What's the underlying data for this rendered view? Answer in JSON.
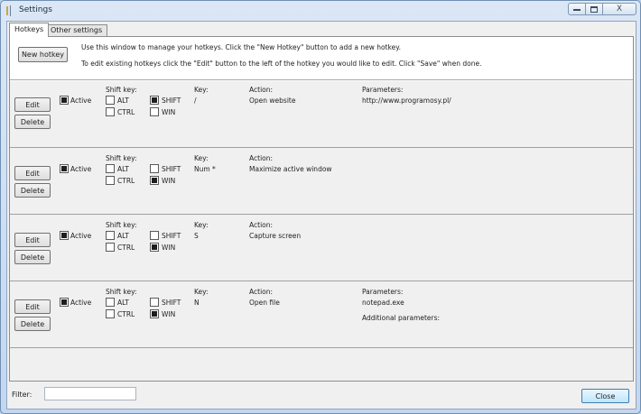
{
  "window": {
    "title": "Settings",
    "close_glyph": "X"
  },
  "tabs": [
    "Hotkeys",
    "Other settings"
  ],
  "intro": {
    "new_hotkey_label": "New hotkey",
    "line1": "Use this window to manage your hotkeys. Click the \"New Hotkey\" button to add a new hotkey.",
    "line2": "To edit existing hotkeys click the \"Edit\" button to the left of the hotkey you would like to edit. Click \"Save\" when done."
  },
  "labels": {
    "edit": "Edit",
    "delete": "Delete",
    "active": "Active",
    "shift_key": "Shift key:",
    "alt": "ALT",
    "shift": "SHIFT",
    "ctrl": "CTRL",
    "win": "WIN",
    "key": "Key:",
    "action": "Action:",
    "parameters": "Parameters:"
  },
  "hotkeys": [
    {
      "active": true,
      "alt": false,
      "shift": true,
      "ctrl": false,
      "win": false,
      "key": "/",
      "action": "Open website",
      "parameters": "http://www.programosy.pl/",
      "additional": ""
    },
    {
      "active": true,
      "alt": false,
      "shift": false,
      "ctrl": false,
      "win": true,
      "key": "Num *",
      "action": "Maximize active window",
      "parameters": "",
      "additional": ""
    },
    {
      "active": true,
      "alt": false,
      "shift": false,
      "ctrl": false,
      "win": true,
      "key": "S",
      "action": "Capture screen",
      "parameters": "",
      "additional": ""
    },
    {
      "active": true,
      "alt": false,
      "shift": false,
      "ctrl": false,
      "win": true,
      "key": "N",
      "action": "Open file",
      "parameters": "notepad.exe",
      "additional": "Additional parameters:"
    }
  ],
  "footer": {
    "filter_label": "Filter:",
    "filter_value": "",
    "close_label": "Close"
  }
}
